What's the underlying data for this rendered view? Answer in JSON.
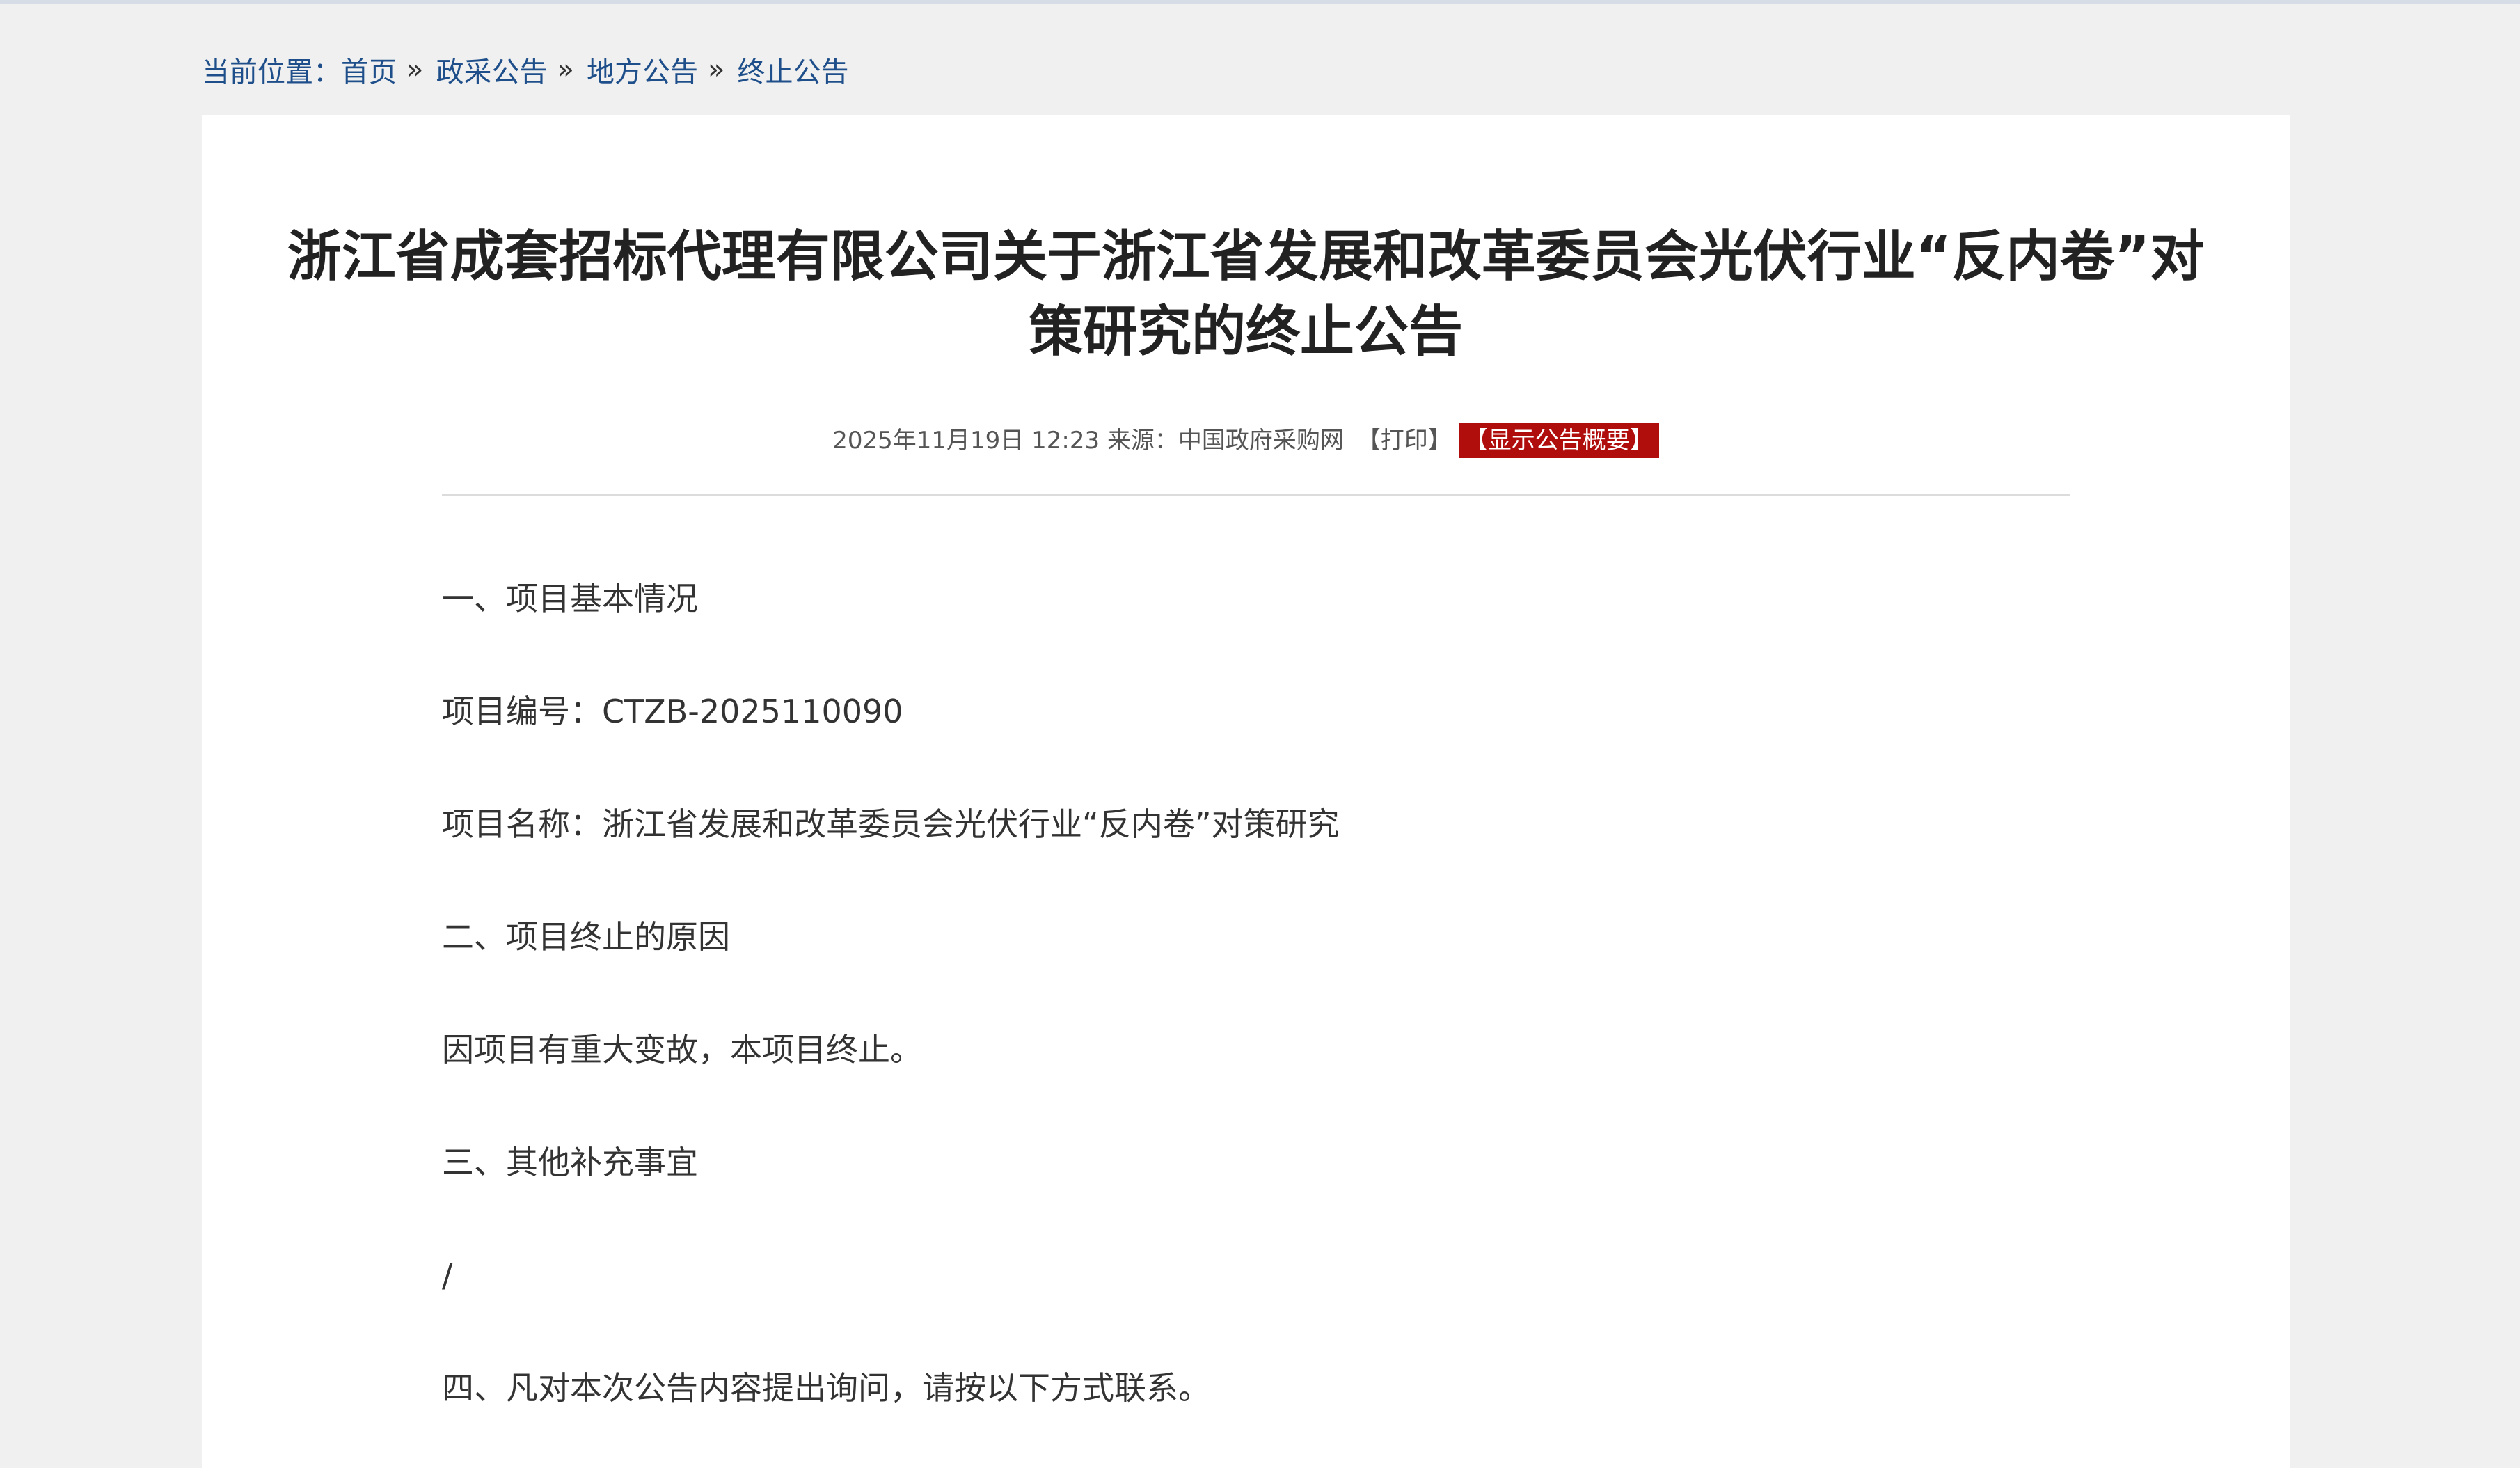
{
  "breadcrumb": {
    "prefix": "当前位置：",
    "items": [
      "首页",
      "政采公告",
      "地方公告",
      "终止公告"
    ],
    "separator": "»"
  },
  "article": {
    "title_line1": "浙江省成套招标代理有限公司关于浙江省发展和改革委员会光伏行业“反内卷”对",
    "title_line2": "策研究的终止公告",
    "datetime": "2025年11月19日 12:23",
    "source_label": "来源：",
    "source": "中国政府采购网",
    "print_label": "【打印】",
    "summary_label": "【显示公告概要】",
    "paragraphs": [
      "一、项目基本情况",
      "项目编号：CTZB-2025110090",
      "项目名称：浙江省发展和改革委员会光伏行业“反内卷”对策研究",
      "二、项目终止的原因",
      "因项目有重大变故，本项目终止。",
      "三、其他补充事宜",
      "/",
      "四、凡对本次公告内容提出询问，请按以下方式联系。"
    ]
  },
  "colors": {
    "link": "#1f4f8a",
    "accent_red": "#b00d0d",
    "page_bg": "#f0f0f0"
  }
}
